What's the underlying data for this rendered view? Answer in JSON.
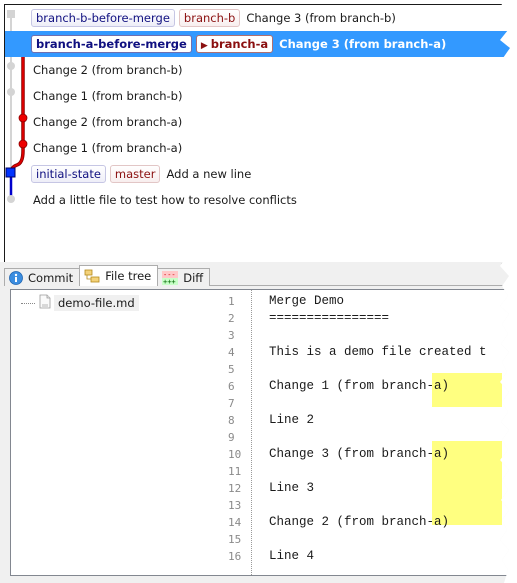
{
  "revision_graph": {
    "rows": [
      {
        "tags": [
          {
            "kind": "label",
            "text": "branch-b-before-merge"
          },
          {
            "kind": "branch",
            "text": "branch-b"
          }
        ],
        "message": "Change 3 (from branch-b)",
        "selected": false
      },
      {
        "tags": [
          {
            "kind": "label",
            "text": "branch-a-before-merge"
          },
          {
            "kind": "branch",
            "text": "branch-a",
            "current": true
          }
        ],
        "message": "Change 3 (from branch-a)",
        "selected": true
      },
      {
        "tags": [],
        "message": "Change 2 (from branch-b)",
        "selected": false
      },
      {
        "tags": [],
        "message": "Change 1 (from branch-b)",
        "selected": false
      },
      {
        "tags": [],
        "message": "Change 2 (from branch-a)",
        "selected": false
      },
      {
        "tags": [],
        "message": "Change 1 (from branch-a)",
        "selected": false
      },
      {
        "tags": [
          {
            "kind": "label",
            "text": "initial-state"
          },
          {
            "kind": "branch",
            "text": "master"
          }
        ],
        "message": "Add a new line",
        "selected": false
      },
      {
        "tags": [],
        "message": "Add a little file to test how to resolve conflicts",
        "selected": false
      }
    ]
  },
  "tabs": [
    {
      "label": "Commit",
      "icon": "info-icon",
      "active": false
    },
    {
      "label": "File tree",
      "icon": "file-tree-icon",
      "active": true
    },
    {
      "label": "Diff",
      "icon": "diff-icon",
      "active": false
    }
  ],
  "file_tree": {
    "items": [
      {
        "label": "demo-file.md",
        "icon": "file-icon"
      }
    ]
  },
  "editor": {
    "lines": [
      {
        "n": "1",
        "text": "Merge Demo"
      },
      {
        "n": "2",
        "text": "================"
      },
      {
        "n": "3",
        "text": ""
      },
      {
        "n": "4",
        "text": "This is a demo file created t"
      },
      {
        "n": "5",
        "text": ""
      },
      {
        "n": "6",
        "text": "Change 1 (from branch-a)"
      },
      {
        "n": "7",
        "text": ""
      },
      {
        "n": "8",
        "text": "Line 2"
      },
      {
        "n": "9",
        "text": ""
      },
      {
        "n": "10",
        "text": "Change 3 (from branch-a)"
      },
      {
        "n": "11",
        "text": ""
      },
      {
        "n": "12",
        "text": "Line 3"
      },
      {
        "n": "13",
        "text": ""
      },
      {
        "n": "14",
        "text": "Change 2 (from branch-a)"
      },
      {
        "n": "15",
        "text": ""
      },
      {
        "n": "16",
        "text": "Line 4"
      }
    ],
    "highlight_color": "#ffff80",
    "highlight_lines": [
      "6",
      "14"
    ]
  },
  "colors": {
    "selection": "#3399ff",
    "branch_a_line": "#cc0000",
    "master_line": "#0000cc",
    "inactive_line": "#d0d0d0"
  }
}
